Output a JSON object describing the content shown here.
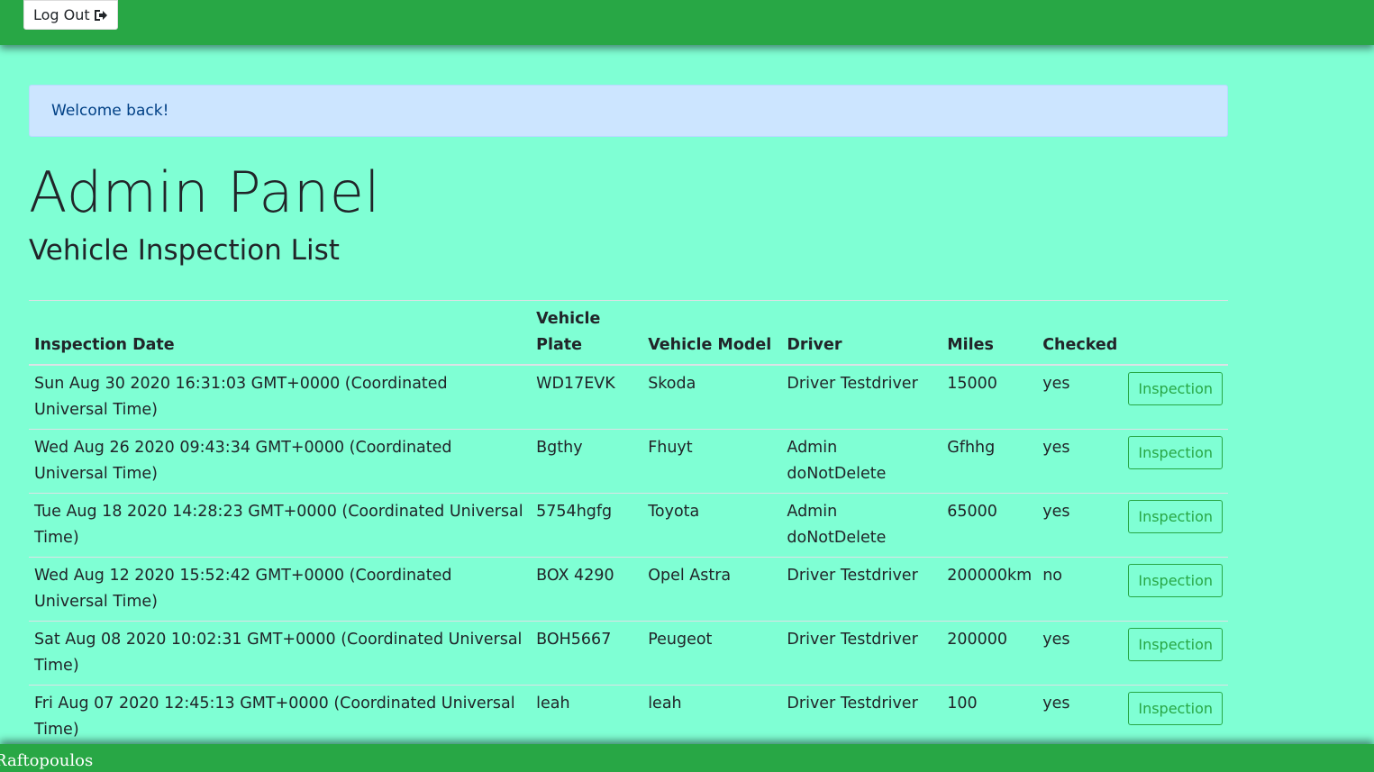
{
  "header": {
    "logout_label": "Log Out",
    "logout_icon": "sign-out-icon"
  },
  "alert": {
    "message": "Welcome back!"
  },
  "page": {
    "title": "Admin Panel",
    "subtitle": "Vehicle Inspection List"
  },
  "table": {
    "headers": {
      "date": "Inspection Date",
      "plate": "Vehicle Plate",
      "model": "Vehicle Model",
      "driver": "Driver",
      "miles": "Miles",
      "checked": "Checked"
    },
    "rows": [
      {
        "date": "Sun Aug 30 2020 16:31:03 GMT+0000 (Coordinated Universal Time)",
        "plate": "WD17EVK",
        "model": "Skoda",
        "driver": "Driver Testdriver",
        "miles": "15000",
        "checked": "yes",
        "action": "Inspection"
      },
      {
        "date": "Wed Aug 26 2020 09:43:34 GMT+0000 (Coordinated Universal Time)",
        "plate": "Bgthy",
        "model": "Fhuyt",
        "driver": "Admin doNotDelete",
        "miles": "Gfhhg",
        "checked": "yes",
        "action": "Inspection"
      },
      {
        "date": "Tue Aug 18 2020 14:28:23 GMT+0000 (Coordinated Universal Time)",
        "plate": "5754hgfg",
        "model": "Toyota",
        "driver": "Admin doNotDelete",
        "miles": "65000",
        "checked": "yes",
        "action": "Inspection"
      },
      {
        "date": "Wed Aug 12 2020 15:52:42 GMT+0000 (Coordinated Universal Time)",
        "plate": "BOX 4290",
        "model": "Opel Astra",
        "driver": "Driver Testdriver",
        "miles": "200000km",
        "checked": "no",
        "action": "Inspection"
      },
      {
        "date": "Sat Aug 08 2020 10:02:31 GMT+0000 (Coordinated Universal Time)",
        "plate": "BOH5667",
        "model": "Peugeot",
        "driver": "Driver Testdriver",
        "miles": "200000",
        "checked": "yes",
        "action": "Inspection"
      },
      {
        "date": "Fri Aug 07 2020 12:45:13 GMT+0000 (Coordinated Universal Time)",
        "plate": "leah",
        "model": "leah",
        "driver": "Driver Testdriver",
        "miles": "100",
        "checked": "yes",
        "action": "Inspection"
      }
    ]
  },
  "footer": {
    "text": "Raftopoulos"
  },
  "colors": {
    "navbar": "#28a745",
    "background": "#7fffd4",
    "alert_bg": "#cce5ff",
    "alert_text": "#004085",
    "button_outline": "#28a745"
  }
}
